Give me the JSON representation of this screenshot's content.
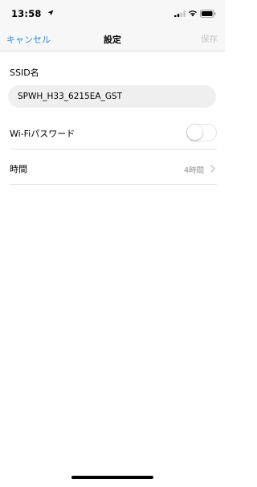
{
  "status_bar": {
    "time": "13:58"
  },
  "nav": {
    "cancel_label": "キャンセル",
    "title": "設定",
    "save_label": "保存"
  },
  "ssid": {
    "label": "SSID名",
    "value": "SPWH_H33_6215EA_GST"
  },
  "wifi_password": {
    "label": "Wi-Fiパスワード",
    "enabled": false
  },
  "duration": {
    "label": "時間",
    "value": "4時間"
  },
  "colors": {
    "accent": "#2f8ad8",
    "disabled": "#c6c6c6",
    "secondary_text": "#8e8e93",
    "bar_background": "#f7f7f7",
    "input_background": "#efefef"
  },
  "icons": [
    "location-arrow-icon",
    "cellular-signal-icon",
    "wifi-icon",
    "battery-icon",
    "chevron-right-icon"
  ]
}
